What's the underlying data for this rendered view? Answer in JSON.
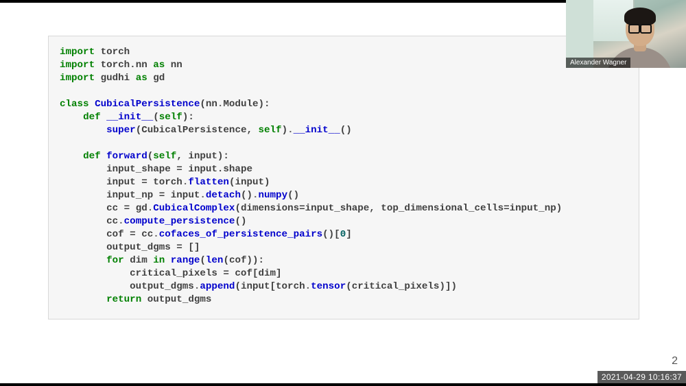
{
  "presenter": {
    "name": "Alexander Wagner"
  },
  "timestamp": "2021-04-29  10:16:37",
  "page_number": "2",
  "code": {
    "imports": [
      {
        "kw": "import",
        "mod": "torch"
      },
      {
        "kw": "import",
        "mod": "torch.nn",
        "as_kw": "as",
        "alias": "nn"
      },
      {
        "kw": "import",
        "mod": "gudhi",
        "as_kw": "as",
        "alias": "gd"
      }
    ],
    "class_kw": "class",
    "class_name": "CubicalPersistence",
    "base_ns": "nn",
    "base_cls": "Module",
    "def_kw": "def",
    "init_name": "__init__",
    "self_kw": "self",
    "super_name": "super",
    "super_arg_cls": "CubicalPersistence",
    "init_call": "__init__",
    "forward_name": "forward",
    "forward_param": "input",
    "line_shape": "input_shape = input.shape",
    "flatten_l": "input = torch",
    "flatten_fn": "flatten",
    "flatten_r": "(input)",
    "detach_l": "input_np = input",
    "detach_fn1": "detach",
    "detach_fn2": "numpy",
    "cc_l": "cc = gd",
    "cc_cls": "CubicalComplex",
    "cc_args": "(dimensions=input_shape, top_dimensional_cells=input_np)",
    "cc_compute_l": "cc",
    "cc_compute_fn": "compute_persistence",
    "cof_l": "cof = cc",
    "cof_fn": "cofaces_of_persistence_pairs",
    "cof_idx": "0",
    "out_init": "output_dgms = []",
    "for_kw": "for",
    "loop_var": "dim",
    "in_kw": "in",
    "range_name": "range",
    "len_name": "len",
    "range_arg": "cof",
    "crit_line": "critical_pixels = cof[dim]",
    "append_l": "output_dgms",
    "append_fn": "append",
    "append_inner_l": "(input[torch",
    "tensor_fn": "tensor",
    "append_inner_r": "(critical_pixels)])",
    "return_kw": "return",
    "return_val": "output_dgms"
  }
}
